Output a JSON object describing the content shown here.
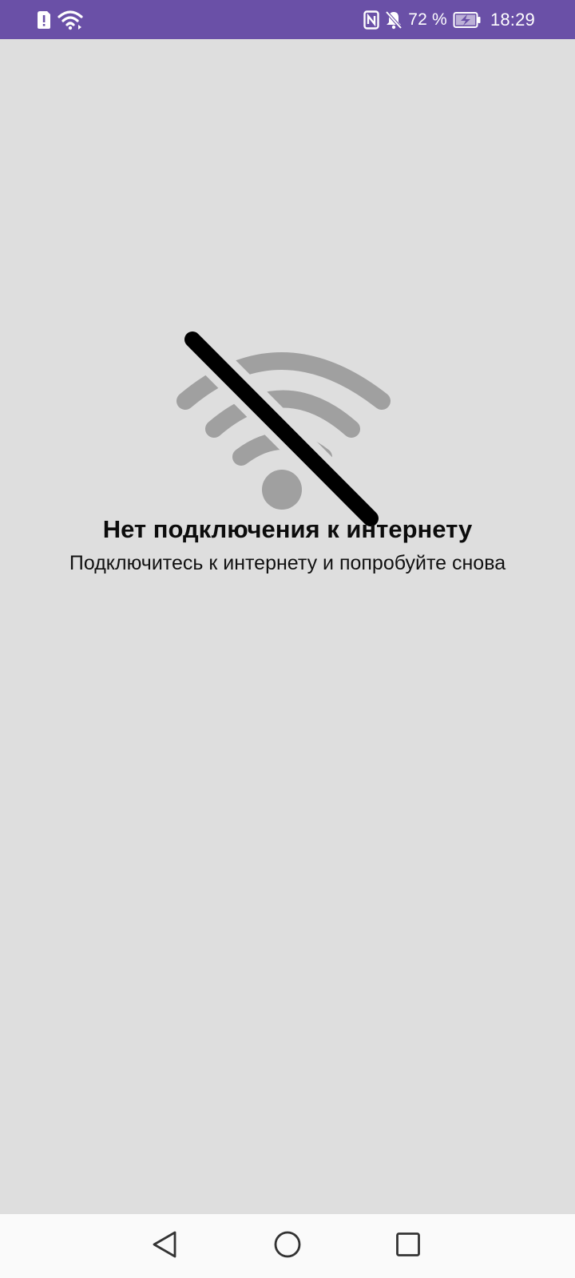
{
  "status_bar": {
    "battery_percent": "72 %",
    "time": "18:29",
    "icons": [
      "sim-alert-icon",
      "wifi-icon",
      "nfc-icon",
      "notifications-off-icon",
      "battery-charging-icon"
    ],
    "background_color": "#6a50a7"
  },
  "error_screen": {
    "title": "Нет подключения к интернету",
    "subtitle": "Подключитесь к интернету и попробуйте снова",
    "illustration_icon": "no-wifi-icon",
    "background_color": "#dedede"
  },
  "nav_bar": {
    "buttons": [
      "back-icon",
      "home-icon",
      "recents-icon"
    ]
  }
}
